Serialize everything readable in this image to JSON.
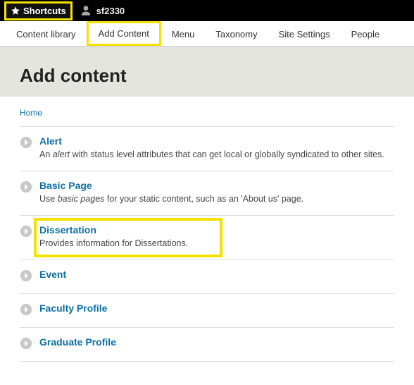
{
  "topbar": {
    "shortcuts_label": "Shortcuts",
    "username": "sf2330"
  },
  "tabs": {
    "content_library": "Content library",
    "add_content": "Add Content",
    "menu": "Menu",
    "taxonomy": "Taxonomy",
    "site_settings": "Site Settings",
    "people": "People"
  },
  "page": {
    "title": "Add content",
    "breadcrumb": "Home"
  },
  "types": {
    "alert": {
      "title": "Alert",
      "desc_pre": "An ",
      "desc_em": "alert",
      "desc_post": " with status level attributes that can get local or globally syndicated to other sites."
    },
    "basic_page": {
      "title": "Basic Page",
      "desc_pre": "Use ",
      "desc_em": "basic pages",
      "desc_post": " for your static content, such as an 'About us' page."
    },
    "dissertation": {
      "title": "Dissertation",
      "desc": "Provides information for Dissertations."
    },
    "event": {
      "title": "Event"
    },
    "faculty_profile": {
      "title": "Faculty Profile"
    },
    "graduate_profile": {
      "title": "Graduate Profile"
    }
  }
}
